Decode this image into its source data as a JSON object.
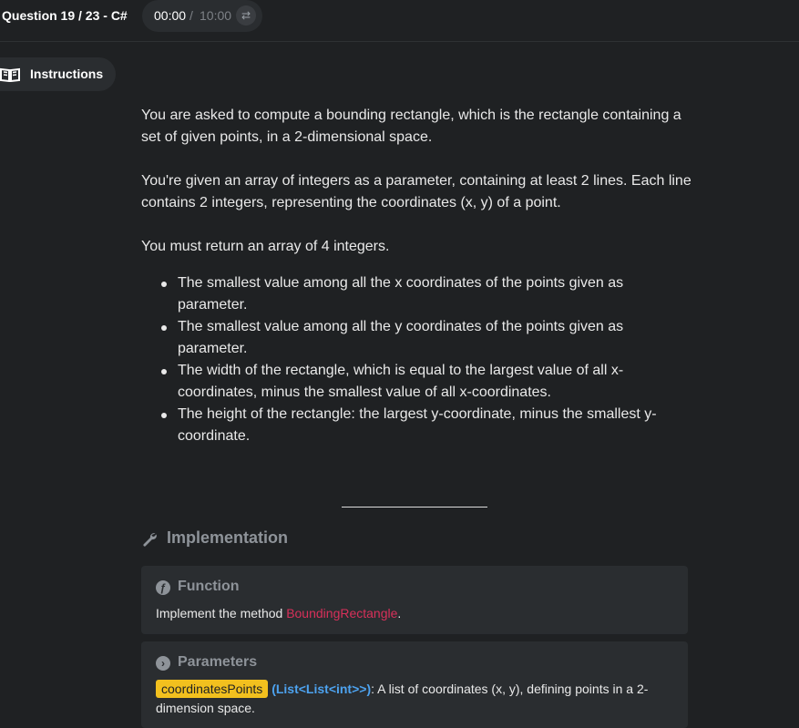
{
  "header": {
    "question": "Question 19 / 23 - C#",
    "timer_elapsed": "00:00",
    "timer_separator": "/",
    "timer_total": "10:00",
    "swap_icon": "swap-arrows-icon"
  },
  "sidebar": {
    "instructions_label": "Instructions",
    "instructions_icon": "open-book-icon"
  },
  "instructions": {
    "p1": "You are asked to compute a bounding rectangle, which is the rectangle containing a set of given points, in a 2-dimensional space.",
    "p2": "You're given an array of integers as a parameter, containing at least 2 lines. Each line contains 2 integers, representing the coordinates (x, y) of a point.",
    "p3": "You must return an array of 4 integers.",
    "bullets": [
      "The smallest value among all the x coordinates of the points given as parameter.",
      "The smallest value among all the y coordinates of the points given as parameter.",
      "The width of the rectangle, which is equal to the largest value of all x-coordinates, minus the smallest value of all x-coordinates.",
      "The height of the rectangle: the largest y-coordinate, minus the smallest y-coordinate."
    ]
  },
  "implementation": {
    "title": "Implementation",
    "function": {
      "title": "Function",
      "text_before": "Implement the method ",
      "method": "BoundingRectangle",
      "text_after": "."
    },
    "parameters": {
      "title": "Parameters",
      "name": "coordinatesPoints",
      "type_open": "(",
      "type": "List<List<int>>",
      "type_close": ")",
      "description": ": A list of coordinates (x, y), defining points in a 2-dimension space."
    }
  },
  "colors": {
    "background": "#1f2123",
    "card": "#2a2d30",
    "method": "#d8305a",
    "param_tag": "#f2c01e",
    "type": "#4da3f0"
  }
}
